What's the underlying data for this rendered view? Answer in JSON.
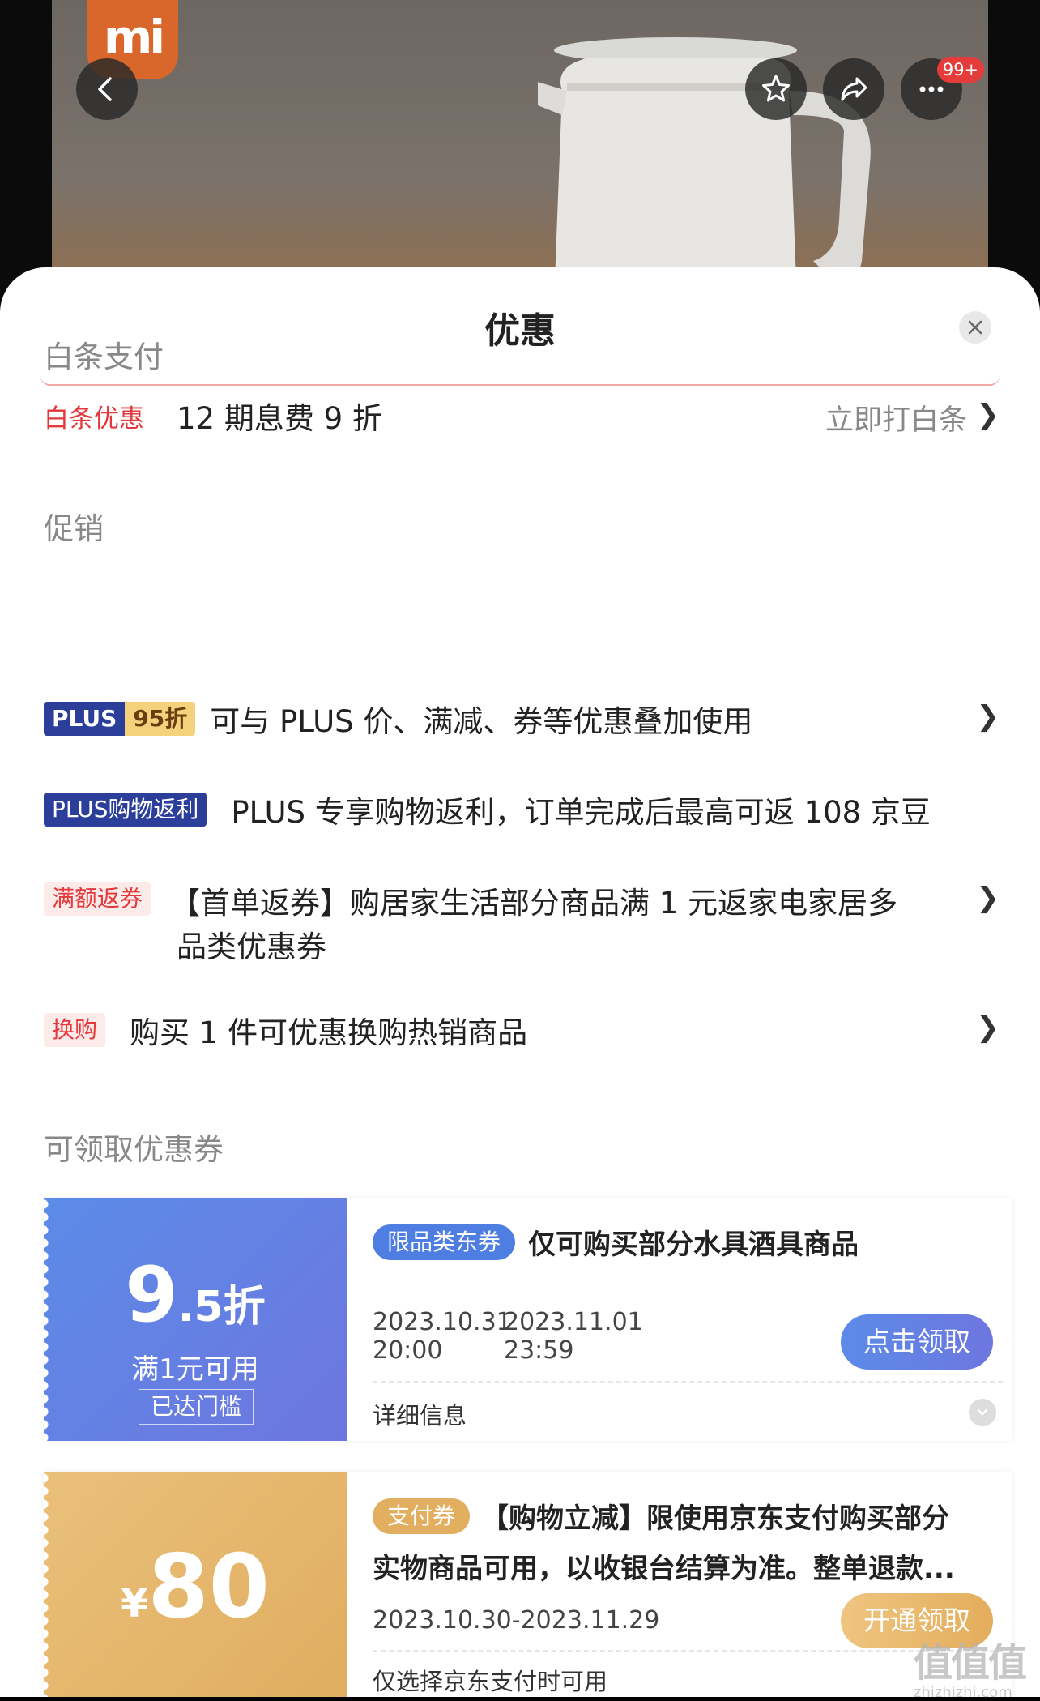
{
  "header": {
    "brand_logo": "mi",
    "badge_count": "99+",
    "icons": [
      "back-arrow-icon",
      "star-icon",
      "share-icon",
      "more-icon"
    ]
  },
  "sheet": {
    "title": "优惠"
  },
  "baitiao": {
    "section_title": "白条支付",
    "tag": "白条优惠",
    "text": "12 期息费 9 折",
    "link": "立即打白条"
  },
  "promotion": {
    "section_title": "促销",
    "items": [
      {
        "tag_main": "PLUS",
        "tag_sub": "95折",
        "text": "可与 PLUS 价、满减、券等优惠叠加使用"
      },
      {
        "tag": "PLUS购物返利",
        "text": "PLUS 专享购物返利，订单完成后最高可返 108 京豆"
      },
      {
        "tag": "满额返券",
        "text_line1": "【首单返券】购居家生活部分商品满 1 元返家电家居多",
        "text_line2": "品类优惠券"
      },
      {
        "tag": "换购",
        "text": "购买 1 件可优惠换购热销商品"
      }
    ]
  },
  "coupons": {
    "section_title": "可领取优惠券",
    "items": [
      {
        "value_big": "9",
        "value_small": ".5折",
        "condition": "满1元可用",
        "status": "已达门槛",
        "tag": "限品类东券",
        "title": "仅可购买部分水具酒具商品",
        "date_start": "2023.10.31",
        "time_start": "20:00",
        "date_end": "2023.11.01",
        "time_end": "23:59",
        "button": "点击领取",
        "details": "详细信息"
      },
      {
        "currency": "¥",
        "value": "80",
        "tag": "支付券",
        "title_line1": "【购物立减】限使用京东支付购买部分",
        "title_line2": "实物商品可用，以收银台结算为准。整单退款...",
        "date_range": "2023.10.30-2023.11.29",
        "button": "开通领取",
        "note": "仅选择京东支付时可用"
      }
    ]
  },
  "watermark": {
    "text": "值值值",
    "url": "zhizhizhi.com"
  },
  "colors": {
    "red": "#e4393c",
    "plus_blue": "#2a3e9a",
    "coupon_blue": "#5c8be8",
    "coupon_gold": "#e2ae5f"
  }
}
